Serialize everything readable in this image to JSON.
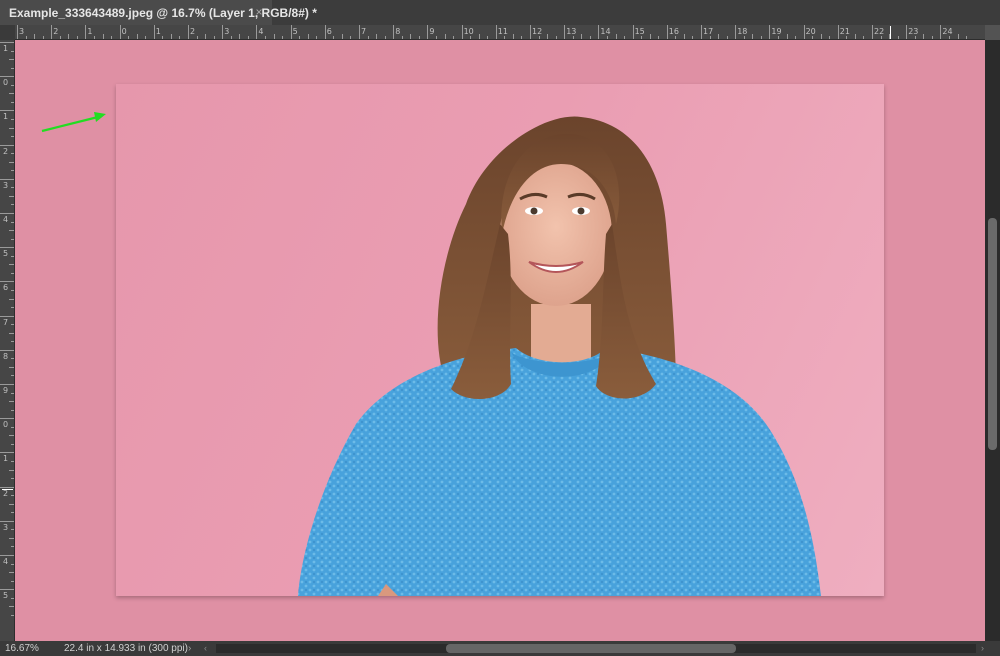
{
  "tab": {
    "title": "Example_333643489.jpeg @ 16.7% (Layer 1, RGB/8#) *",
    "close_label": "×"
  },
  "ruler": {
    "h_labels": [
      "3",
      "2",
      "1",
      "0",
      "1",
      "2",
      "3",
      "4",
      "5",
      "6",
      "7",
      "8",
      "9",
      "10",
      "11",
      "12",
      "13",
      "14",
      "15",
      "16",
      "17",
      "18",
      "19",
      "20",
      "21",
      "22",
      "23",
      "24"
    ],
    "v_labels": [
      "1",
      "0",
      "1",
      "2",
      "3",
      "4",
      "5",
      "6",
      "7",
      "8",
      "9",
      "0",
      "1",
      "2",
      "3",
      "4",
      "5"
    ]
  },
  "status": {
    "zoom": "16.67%",
    "doc_info": "22.4 in x 14.933 in (300 ppi)",
    "expand_glyph": "›",
    "scroll_left": "‹",
    "scroll_right": "›"
  },
  "colors": {
    "canvas_background": "#df90a4",
    "photo_background": "#eaa0b4",
    "arrow": "#22dd22",
    "sweater": "#4aa3dc",
    "hair": "#7a4f34"
  },
  "icons": {
    "annotation": "green-arrow-icon",
    "close": "close-icon"
  }
}
